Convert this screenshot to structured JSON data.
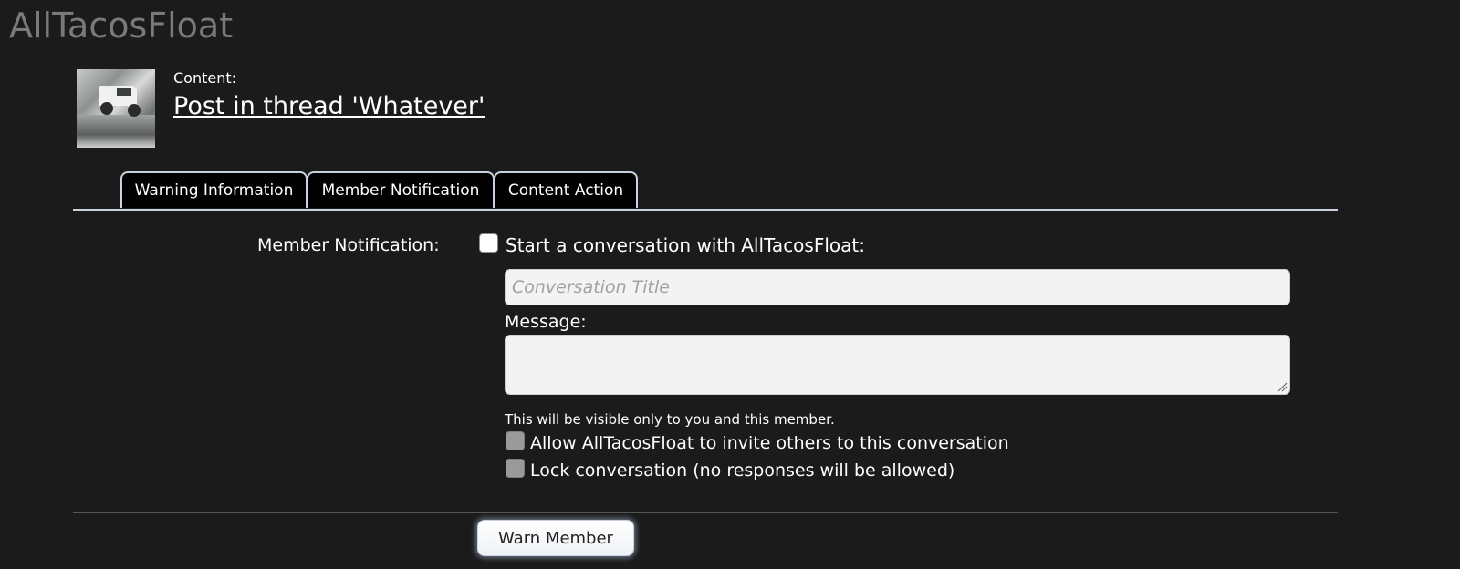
{
  "site": {
    "title": "AllTacosFloat"
  },
  "content": {
    "label": "Content:",
    "link_text": "Post in thread 'Whatever'"
  },
  "tabs": [
    {
      "label": "Warning Information"
    },
    {
      "label": "Member Notification",
      "active": true
    },
    {
      "label": "Content Action"
    }
  ],
  "notification": {
    "label": "Member Notification:",
    "start_conversation_label": "Start a conversation with AllTacosFloat:",
    "start_conversation_checked": false,
    "title_placeholder": "Conversation Title",
    "title_value": "",
    "message_label": "Message:",
    "message_value": "",
    "visibility_hint": "This will be visible only to you and this member.",
    "options": [
      {
        "label": "Allow AllTacosFloat to invite others to this conversation",
        "checked": false,
        "disabled": true
      },
      {
        "label": "Lock conversation (no responses will be allowed)",
        "checked": false,
        "disabled": true
      }
    ]
  },
  "actions": {
    "warn_button": "Warn Member"
  },
  "colors": {
    "background": "#1b1b1b",
    "site_title": "#7a7a7a",
    "tab_border": "#c9d3e0",
    "input_background": "#f3f3f3"
  }
}
